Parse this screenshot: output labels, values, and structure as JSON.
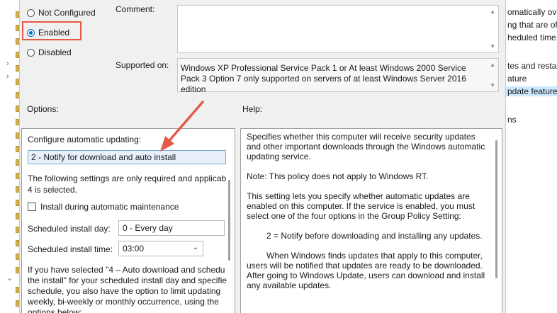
{
  "policy_state": {
    "not_configured": "Not Configured",
    "enabled": "Enabled",
    "disabled": "Disabled"
  },
  "comment_label": "Comment:",
  "supported_label": "Supported on:",
  "supported_text": "Windows XP Professional Service Pack 1 or At least Windows 2000 Service Pack 3 Option 7 only supported on servers of at least Windows Server 2016 edition",
  "options_label": "Options:",
  "help_label": "Help:",
  "options": {
    "configure_label": "Configure automatic updating:",
    "selected_value": "2 - Notify for download and auto install",
    "note": "The following settings are only required and applicab",
    "note2": "4 is selected.",
    "install_maintenance": "Install during automatic maintenance",
    "install_day_label": "Scheduled install day:",
    "install_day_value": "0 - Every day",
    "install_time_label": "Scheduled install time:",
    "install_time_value": "03:00",
    "desc1": "If you have selected \"4 – Auto download and schedu",
    "desc2": "the install\" for your scheduled install day and specifie",
    "desc3": "schedule, you also have the option to limit updating",
    "desc4": "weekly, bi-weekly or monthly occurrence, using the",
    "desc5": "options below:"
  },
  "help": {
    "p1": "Specifies whether this computer will receive security updates and other important downloads through the Windows automatic updating service.",
    "p2": "Note: This policy does not apply to Windows RT.",
    "p3": "This setting lets you specify whether automatic updates are enabled on this computer. If the service is enabled, you must select one of the four options in the Group Policy Setting:",
    "p4": "2 = Notify before downloading and installing any updates.",
    "p5": "When Windows finds updates that apply to this computer, users will be notified that updates are ready to be downloaded. After going to Windows Update, users can download and install any available updates."
  },
  "background_right": {
    "line1": "omatically ov",
    "line2": "ng that are of",
    "line3": "heduled time",
    "line4": "tes and restar",
    "line5": "ature",
    "line6": "pdate features",
    "line7": "ns"
  },
  "colors": {
    "accent": "#0067c0",
    "annotation_red": "#e25a4a"
  }
}
